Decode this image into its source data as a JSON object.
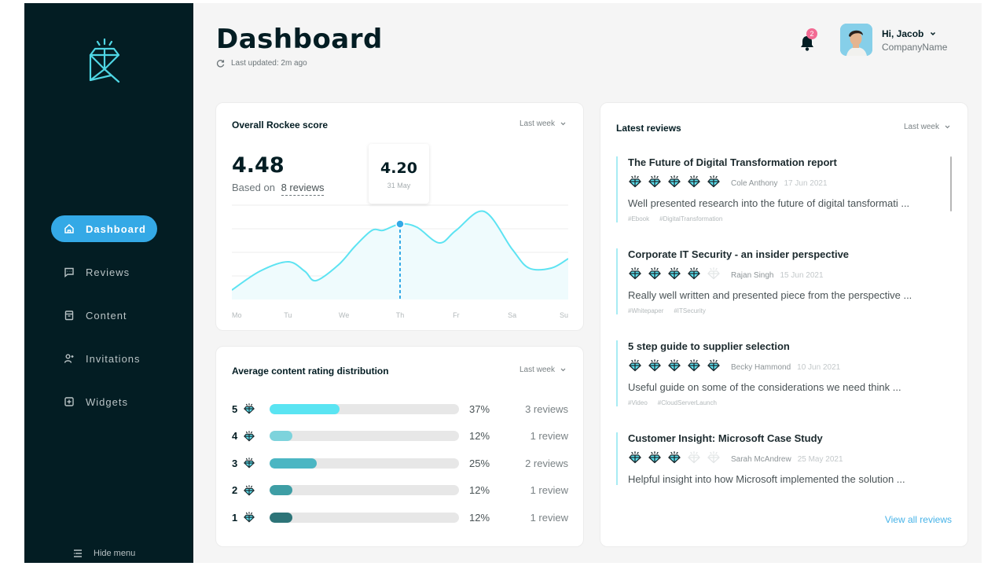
{
  "sidebar": {
    "logo_icon": "diamond-r-logo",
    "items": [
      {
        "label": "Dashboard",
        "icon": "home-icon",
        "active": true
      },
      {
        "label": "Reviews",
        "icon": "message-icon",
        "active": false
      },
      {
        "label": "Content",
        "icon": "archive-icon",
        "active": false
      },
      {
        "label": "Invitations",
        "icon": "user-plus-icon",
        "active": false
      },
      {
        "label": "Widgets",
        "icon": "plus-square-icon",
        "active": false
      }
    ],
    "hide_menu_label": "Hide menu"
  },
  "header": {
    "title": "Dashboard",
    "last_updated": "Last updated: 2m ago",
    "notification_count": "2",
    "user_greeting": "Hi, Jacob",
    "company": "CompanyName"
  },
  "score_card": {
    "title": "Overall Rockee score",
    "period": "Last week",
    "score": "4.48",
    "based_on_prefix": "Based on",
    "reviews_link": "8 reviews",
    "tooltip_value": "4.20",
    "tooltip_date": "31 May"
  },
  "chart_data": {
    "type": "line",
    "title": "Overall Rockee score",
    "categories": [
      "Mo",
      "Tu",
      "We",
      "Th",
      "Fr",
      "Sa",
      "Su"
    ],
    "x": [
      0,
      0.5,
      1,
      1.3,
      1.5,
      1.9,
      2.2,
      2.5,
      2.7,
      3,
      3.3,
      3.7,
      4,
      4.5,
      5,
      5.3,
      5.7,
      6
    ],
    "values": [
      3.15,
      3.45,
      3.6,
      3.45,
      3.3,
      3.55,
      3.85,
      4.1,
      4.1,
      4.2,
      4.15,
      3.9,
      4.1,
      4.4,
      3.8,
      3.5,
      3.5,
      3.65
    ],
    "highlight": {
      "x": 3,
      "value": 4.2,
      "label": "31 May"
    },
    "ylim": [
      3.0,
      4.5
    ],
    "grid": true,
    "xlabel": "",
    "ylabel": "",
    "colors": {
      "line": "#5de3f2",
      "area": "#effbfd",
      "marker": "#34a9e6"
    }
  },
  "distribution": {
    "title": "Average content rating distribution",
    "period": "Last week",
    "rows": [
      {
        "rating": "5",
        "percent": 37,
        "percent_label": "37%",
        "count_label": "3 reviews",
        "color": "#5ae4f2"
      },
      {
        "rating": "4",
        "percent": 12,
        "percent_label": "12%",
        "count_label": "1 review",
        "color": "#7dd3dc"
      },
      {
        "rating": "3",
        "percent": 25,
        "percent_label": "25%",
        "count_label": "2 reviews",
        "color": "#4bb6c3"
      },
      {
        "rating": "2",
        "percent": 12,
        "percent_label": "12%",
        "count_label": "1 review",
        "color": "#3e9ea5"
      },
      {
        "rating": "1",
        "percent": 12,
        "percent_label": "12%",
        "count_label": "1 review",
        "color": "#2d7478"
      }
    ]
  },
  "latest_reviews": {
    "title": "Latest reviews",
    "period": "Last week",
    "items": [
      {
        "title": "The Future of Digital Transformation report",
        "rating": 5,
        "author": "Cole Anthony",
        "date": "17 Jun 2021",
        "excerpt": "Well presented research into the future of digital tansformati ...",
        "tags": [
          "#Ebook",
          "#DigitalTransformation"
        ]
      },
      {
        "title": "Corporate IT Security - an insider perspective",
        "rating": 4,
        "author": "Rajan Singh",
        "date": "15 Jun 2021",
        "excerpt": "Really well written and presented piece from the perspective ...",
        "tags": [
          "#Whitepaper",
          "#ITSecurity"
        ]
      },
      {
        "title": "5 step guide to supplier selection",
        "rating": 5,
        "author": "Becky Hammond",
        "date": "10 Jun 2021",
        "excerpt": "Useful guide on some of the considerations we need think ...",
        "tags": [
          "#Video",
          "#CloudServerLaunch"
        ]
      },
      {
        "title": "Customer Insight: Microsoft Case Study",
        "rating": 3,
        "author": "Sarah McAndrew",
        "date": "25 May 2021",
        "excerpt": "Helpful insight into how Microsoft implemented the solution ...",
        "tags": []
      }
    ],
    "view_all_label": "View all reviews"
  },
  "colors": {
    "sidebar_bg": "#031d23",
    "accent": "#34a9e6",
    "brand_teal": "#5de3f2",
    "notification": "#f26a93"
  }
}
